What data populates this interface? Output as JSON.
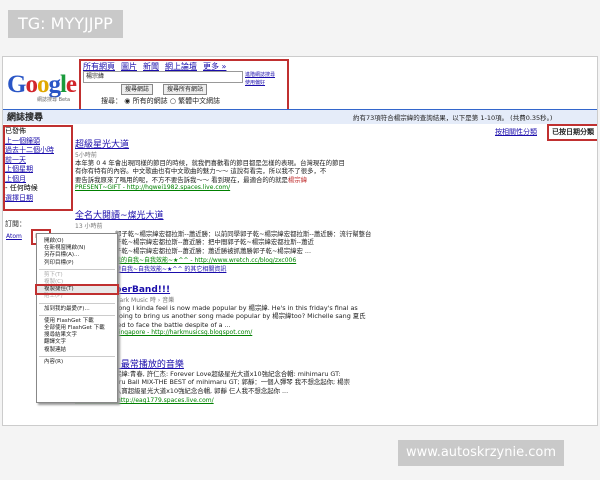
{
  "overlay_tag": "TG: MYYJJPP",
  "watermark": "www.autoskrzynie.com",
  "header": {
    "logo": {
      "G": "G",
      "o1": "o",
      "o2": "o",
      "g": "g",
      "l": "l",
      "e": "e",
      "sub": "網誌搜尋 Beta"
    },
    "tabs": [
      "所有網頁",
      "圖片",
      "新聞",
      "網上論壇",
      "更多 »"
    ],
    "search_value": "楊宗緯",
    "buttons": [
      "搜尋網誌",
      "搜尋所有網站"
    ],
    "advanced_links": [
      "進階網誌搜尋",
      "使用偏好"
    ],
    "radio_prefix": "搜尋：",
    "radio_all": "所有的網誌",
    "radio_zh": "繁體中文網誌"
  },
  "bar": {
    "title": "網誌搜尋",
    "info": "約有73項符合楊宗緯的查詢結果，以下是第 1-10項。 (共費0.35秒。)",
    "sort_relevance": "按相關性分類",
    "sort_date": "已按日期分類"
  },
  "sidebar": {
    "heading": "已發佈",
    "items": [
      "上一個鐘頭",
      "過去十二個小時",
      "前一天",
      "上個星期",
      "上個月"
    ],
    "any_time": "- 任何時候",
    "choose_date": "選擇日期",
    "subscribe": "訂閱：",
    "atom": "Atom",
    "rss": "RSS"
  },
  "context_menu": {
    "items": [
      "開啟(O)",
      "在新視窗開啟(N)",
      "另存目標(A)...",
      "列印目標(P)",
      "剪下(T)",
      "複製(C)",
      "複製捷徑(T)",
      "貼上(P)",
      "加到我的最愛(F)...",
      "使用 FlashGet 下載",
      "全部使用 FlashGet 下載",
      "搜尋結果文字",
      "翻譯文字",
      "複製連結",
      "內容(R)"
    ]
  },
  "results": [
    {
      "title": "超級星光大道",
      "meta": "5小時前",
      "snippet": [
        "本年第 0 4 年會出現同樣的節目的時候，就我們喜歡看的節目都是怎樣的表現。台灣現在的節目",
        "有你有特有的內容。中文歌曲也有中文歌曲的魅力～～ 這說有看完，所以我不了很多，不",
        "要告訴我原來了嗎用的呢，不方不要告訴我～～ 看到現在，最適合的的就是"
      ],
      "highlight": "楊宗緯",
      "url": "PRESENT~GIFT - http://hgwei1982.spaces.live.com/"
    },
    {
      "title": "全名大閱讀~燦光大道",
      "meta": "13 小時前",
      "snippet": [
        "郭子乾~楊宗緯宏都拉斯--蕭近勝：以前同學郭子乾~楊宗緯宏都拉斯--蕭近勝：流行幫整台",
        "子乾~楊宗緯宏都拉斯--蕭近勝：把中間郭子乾~楊宗緯宏都拉斯--蕭近",
        "子乾~楊宗緯宏都拉斯--蕭近勝：蕭近勝被抓蕭勝郭子乾~楊宗緯宏 ..."
      ],
      "url": "我的自我~自我效能~★^^ - http://www.wretch.cc/blog/zxc006",
      "url2": "變自我~自我效能~★^^ 的其它相關資訊"
    },
    {
      "title": "perBand!!!",
      "meta": "Hark Music 時 › 音樂",
      "snippet": [
        "song I kinda feel is now made popular by 楊宗緯. He's in this friday's final as",
        "going to bring us another song made popular by 楊宗緯too? Michelle sang 夏氏",
        "red to face the battle despite of a ..."
      ],
      "url": "Singapore - http://harkmusicsg.blogspot.com/"
    },
    {
      "title": ": 最常播放的音樂",
      "meta": "",
      "snippet": [
        "宗緯:青春, 許仁杰: Forever Love超級星光大道x10強紀念合輯: mihimaru GT:",
        "aru Ball MIX-THE BEST of mihimaru GT; 郭靜：一個人彈琴 我不想念起你; 楊崇",
        "入寶超級星光大道x10強紀念合輯, 郭靜 仨人我不想念起你 ..."
      ],
      "url": "~ 心情空間~ - http://eag1779.spaces.live.com/"
    }
  ]
}
